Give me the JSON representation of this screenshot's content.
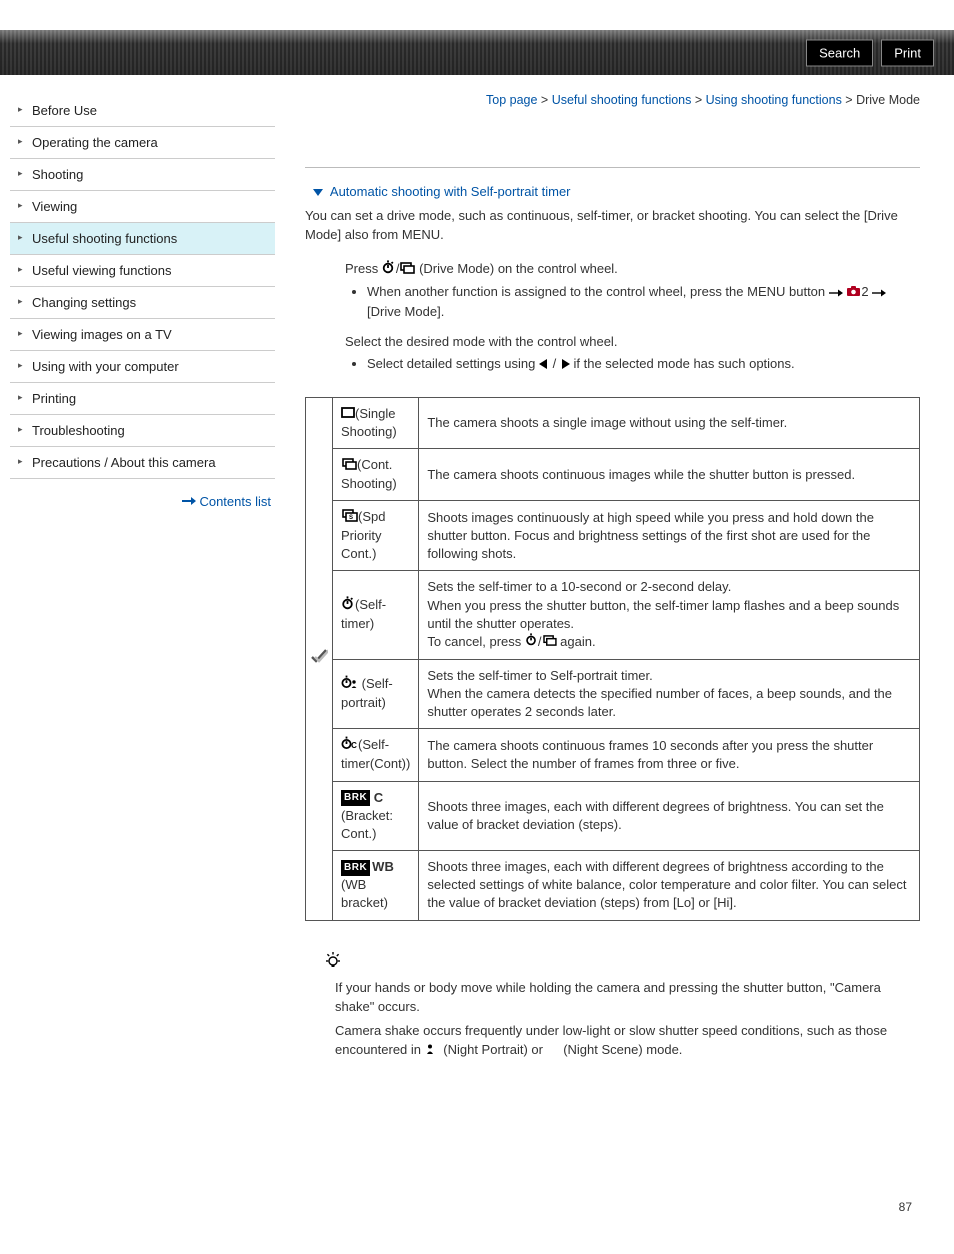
{
  "header": {
    "search_label": "Search",
    "print_label": "Print"
  },
  "sidebar": {
    "items": [
      {
        "label": "Before Use"
      },
      {
        "label": "Operating the camera"
      },
      {
        "label": "Shooting"
      },
      {
        "label": "Viewing"
      },
      {
        "label": "Useful shooting functions",
        "active": true
      },
      {
        "label": "Useful viewing functions"
      },
      {
        "label": "Changing settings"
      },
      {
        "label": "Viewing images on a TV"
      },
      {
        "label": "Using with your computer"
      },
      {
        "label": "Printing"
      },
      {
        "label": "Troubleshooting"
      },
      {
        "label": "Precautions / About this camera"
      }
    ],
    "contents_list": "Contents list"
  },
  "breadcrumb": {
    "top": "Top page",
    "sep": " > ",
    "cat": "Useful shooting functions",
    "sub": "Using shooting functions",
    "page": "Drive Mode"
  },
  "main": {
    "anchor": "Automatic shooting with Self-portrait timer",
    "intro": "You can set a drive mode, such as continuous, self-timer, or bracket shooting. You can select the [Drive Mode] also from MENU.",
    "step1_a": "Press ",
    "step1_b": "(Drive Mode) on the control wheel.",
    "step1_bullet_a": "When another function is assigned to the control wheel, press the MENU button ",
    "step1_bullet_b": "2",
    "step1_bullet_c": " [Drive Mode].",
    "step2": "Select the desired mode with the control wheel.",
    "step2_bullet_a": "Select detailed settings using ",
    "step2_bullet_b": " if the selected mode has such options."
  },
  "table": {
    "rows": [
      {
        "name": "(Single Shooting)",
        "desc": "The camera shoots a single image without using the self-timer."
      },
      {
        "name": "(Cont. Shooting)",
        "desc": "The camera shoots continuous images while the shutter button is pressed."
      },
      {
        "name": "(Spd Priority Cont.)",
        "desc": "Shoots images continuously at high speed while you press and hold down the shutter button. Focus and brightness settings of the first shot are used for the following shots."
      },
      {
        "name": "(Self-timer)",
        "desc_a": "Sets the self-timer to a 10-second or 2-second delay.",
        "desc_b": "When you press the shutter button, the self-timer lamp flashes and a beep sounds until the shutter operates.",
        "desc_c": "To cancel, press ",
        "desc_d": " again."
      },
      {
        "name": "(Self-portrait)",
        "desc_a": "Sets the self-timer to Self-portrait timer.",
        "desc_b": "When the camera detects the specified number of faces, a beep sounds, and the shutter operates 2 seconds later."
      },
      {
        "name": "(Self-timer(Cont))",
        "desc": "The camera shoots continuous frames 10 seconds after you press the shutter button. Select the number of frames from three or five."
      },
      {
        "name": "(Bracket: Cont.)",
        "desc": "Shoots three images, each with different degrees of brightness. You can set the value of bracket deviation (steps)."
      },
      {
        "name": "(WB bracket)",
        "desc": "Shoots three images, each with different degrees of brightness according to the selected settings of white balance, color temperature and color filter. You can select the value of bracket deviation (steps) from [Lo] or [Hi]."
      }
    ]
  },
  "hint": {
    "p1": "If your hands or body move while holding the camera and pressing the shutter button, \"Camera shake\" occurs.",
    "p2a": "Camera shake occurs frequently under low-light or slow shutter speed conditions, such as those encountered in ",
    "p2b": "(Night Portrait) or ",
    "p2c": "(Night Scene) mode."
  },
  "page_number": "87"
}
